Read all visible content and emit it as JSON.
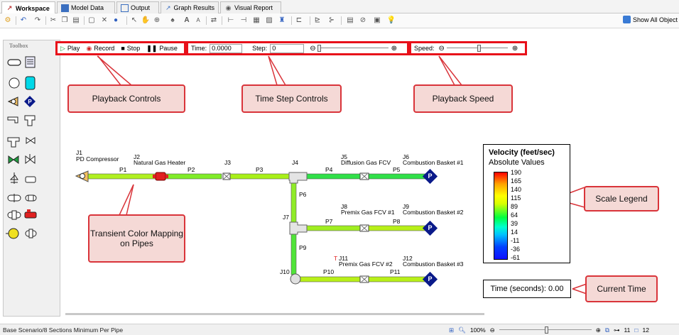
{
  "tabs": [
    {
      "label": "Workspace",
      "icon": "workspace-icon"
    },
    {
      "label": "Model Data",
      "icon": "model-data-icon"
    },
    {
      "label": "Output",
      "icon": "output-icon"
    },
    {
      "label": "Graph Results",
      "icon": "graph-icon"
    },
    {
      "label": "Visual Report",
      "icon": "eye-icon"
    }
  ],
  "toolbar": {
    "show_all_label": "Show All Object"
  },
  "toolbox": {
    "title": "Toolbox"
  },
  "playback": {
    "play": "Play",
    "record": "Record",
    "stop": "Stop",
    "pause": "Pause",
    "time_label": "Time:",
    "time_value": "0.0000",
    "step_label": "Step:",
    "step_value": "0",
    "speed_label": "Speed:"
  },
  "callouts": {
    "playback_controls": "Playback Controls",
    "time_step_controls": "Time Step Controls",
    "playback_speed": "Playback Speed",
    "scale_legend": "Scale Legend",
    "transient_color": "Transient Color Mapping on Pipes",
    "current_time": "Current Time"
  },
  "legend": {
    "title": "Velocity (feet/sec)",
    "subtitle": "Absolute Values",
    "values": [
      "190",
      "165",
      "140",
      "115",
      "89",
      "64",
      "39",
      "14",
      "-11",
      "-36",
      "-61"
    ]
  },
  "time_display": "Time (seconds): 0.00",
  "model": {
    "junctions": [
      {
        "id": "J1",
        "name": "PD Compressor"
      },
      {
        "id": "J2",
        "name": "Natural Gas Heater"
      },
      {
        "id": "J3",
        "name": ""
      },
      {
        "id": "J4",
        "name": ""
      },
      {
        "id": "J5",
        "name": "Diffusion Gas FCV"
      },
      {
        "id": "J6",
        "name": "Combustion Basket #1"
      },
      {
        "id": "J7",
        "name": ""
      },
      {
        "id": "J8",
        "name": "Premix Gas FCV #1"
      },
      {
        "id": "J9",
        "name": "Combustion Basket #2"
      },
      {
        "id": "J10",
        "name": ""
      },
      {
        "id": "J11",
        "name": "Premix Gas FCV #2"
      },
      {
        "id": "J12",
        "name": "Combustion Basket #3"
      }
    ],
    "pipes": [
      "P1",
      "P2",
      "P3",
      "P4",
      "P5",
      "P6",
      "P7",
      "P8",
      "P9",
      "P10",
      "P11"
    ],
    "j11_flag": "T",
    "pump_symbol": "P"
  },
  "status": {
    "scenario": "Base Scenario/8 Sections Minimum Per Pipe",
    "zoom": "100%",
    "count1": "11",
    "count2": "12"
  },
  "colors": {
    "accent_red": "#e8101a",
    "callout_fill": "#f5d9d6",
    "pipe_green": "#44e044",
    "pipe_yellowgreen": "#c8f000",
    "pump_blue": "#0a1a8a"
  }
}
